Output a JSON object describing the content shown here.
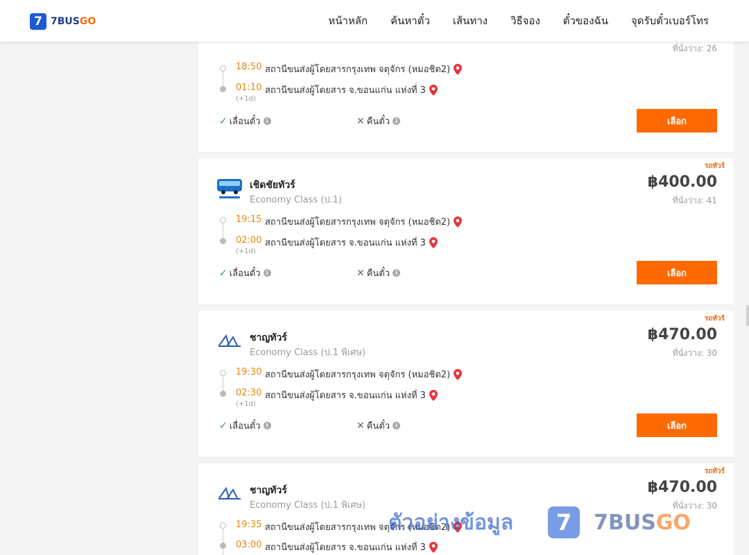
{
  "header": {
    "logo_mark": "7",
    "logo_text_a": "7BUS",
    "logo_text_b": "GO",
    "nav": [
      "หน้าหลัก",
      "ค้นหาตั๋ว",
      "เส้นทาง",
      "วิธีจอง",
      "ตั๋วของฉัน",
      "จุดรับตั๋วเบอร์โทร"
    ]
  },
  "cards": [
    {
      "badge": "",
      "operator": "",
      "class": "",
      "price": "",
      "seats": "ที่นั่งว่าง: 26",
      "depart_time": "18:50",
      "depart_station": "สถานีขนส่งผู้โดยสารกรุงเทพ จตุจักร (หมอชิต2)",
      "arrive_time": "01:10",
      "arrive_station": "สถานีขนส่งผู้โดยสาร จ.ขอนแก่น แห่งที่ 3",
      "next_day": "(+1d)",
      "policy_change": "เลื่อนตั๋ว",
      "policy_refund": "คืนตั๋ว",
      "select": "เลือก"
    },
    {
      "badge": "รถทัวร์",
      "operator": "เชิดชัยทัวร์",
      "class": "Economy Class (ป.1)",
      "price": "฿400.00",
      "seats": "ที่นั่งว่าง: 41",
      "depart_time": "19:15",
      "depart_station": "สถานีขนส่งผู้โดยสารกรุงเทพ จตุจักร (หมอชิต2)",
      "arrive_time": "02:00",
      "arrive_station": "สถานีขนส่งผู้โดยสาร จ.ขอนแก่น แห่งที่ 3",
      "next_day": "(+1d)",
      "policy_change": "เลื่อนตั๋ว",
      "policy_refund": "คืนตั๋ว",
      "select": "เลือก"
    },
    {
      "badge": "รถทัวร์",
      "operator": "ชาญทัวร์",
      "class": "Economy Class (ป.1 พิเศษ)",
      "price": "฿470.00",
      "seats": "ที่นั่งว่าง: 30",
      "depart_time": "19:30",
      "depart_station": "สถานีขนส่งผู้โดยสารกรุงเทพ จตุจักร (หมอชิต2)",
      "arrive_time": "02:30",
      "arrive_station": "สถานีขนส่งผู้โดยสาร จ.ขอนแก่น แห่งที่ 3",
      "next_day": "(+1d)",
      "policy_change": "เลื่อนตั๋ว",
      "policy_refund": "คืนตั๋ว",
      "select": "เลือก"
    },
    {
      "badge": "รถทัวร์",
      "operator": "ชาญทัวร์",
      "class": "Economy Class (ป.1 พิเศษ)",
      "price": "฿470.00",
      "seats": "ที่นั่งว่าง: 30",
      "depart_time": "19:35",
      "depart_station": "สถานีขนส่งผู้โดยสารกรุงเทพ จตุจักร (หมอชิต2)",
      "arrive_time": "03:00",
      "arrive_station": "สถานีขนส่งผู้โดยสาร จ.ขอนแก่น แห่งที่ 3",
      "next_day": "",
      "policy_change": "",
      "policy_refund": "",
      "select": ""
    }
  ],
  "watermark": {
    "text": "ตัวอย่างข้อมูล",
    "logo_mark": "7",
    "brand_a": "7BUS",
    "brand_b": "GO"
  },
  "colors": {
    "accent": "#ff6a00",
    "time": "#e8860c",
    "brand_blue": "#1e5ad6"
  }
}
